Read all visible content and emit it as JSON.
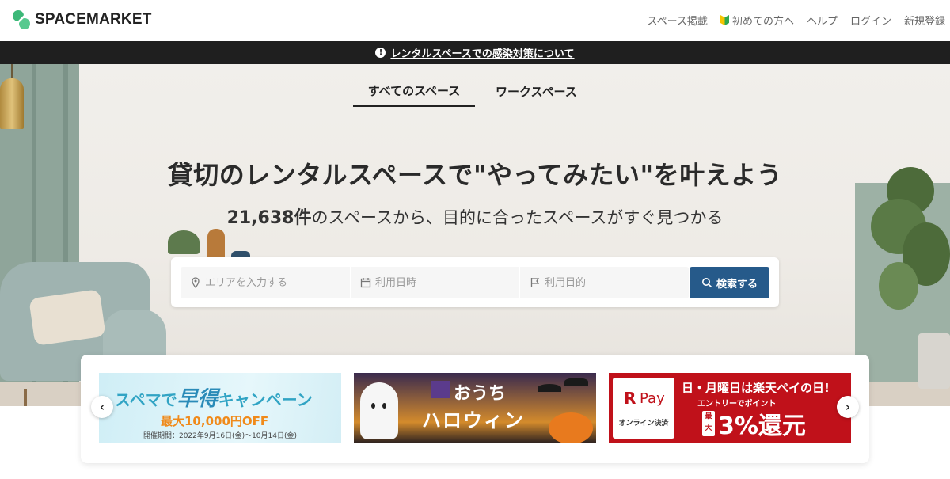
{
  "header": {
    "logo_text": "SPACEMARKET",
    "nav": [
      "スペース掲載",
      "初めての方へ",
      "ヘルプ",
      "ログイン",
      "新規登録"
    ],
    "brand_color": "#3cb878"
  },
  "notice": {
    "icon": "info-icon",
    "text": "レンタルスペースでの感染対策について"
  },
  "hero": {
    "tabs": [
      "すべてのスペース",
      "ワークスペース"
    ],
    "active_tab": 0,
    "headline": "貸切のレンタルスペースで\"やってみたい\"を叶えよう",
    "count": "21,638件",
    "subline_rest": "のスペースから、目的に合ったスペースがすぐ見つかる"
  },
  "search": {
    "area_placeholder": "エリアを入力する",
    "date_placeholder": "利用日時",
    "purpose_placeholder": "利用目的",
    "button_label": "検索する",
    "button_color": "#265a8a"
  },
  "banners": [
    {
      "line1a": "スペマで",
      "line1b": "早得",
      "line1c": "キャンペーン",
      "line2": "最大10,000円OFF",
      "line3": "開催期間：2022年9月16日(金)〜10月14日(金)"
    },
    {
      "line1": "おうち",
      "line2": "ハロウィン"
    },
    {
      "logo_r": "R",
      "logo_pay": "Pay",
      "logo_sub": "オンライン決済",
      "line1": "日・月曜日は楽天ペイの日!",
      "line2": "エントリーでポイント",
      "tag": "最大",
      "pct": "3%還元"
    }
  ]
}
